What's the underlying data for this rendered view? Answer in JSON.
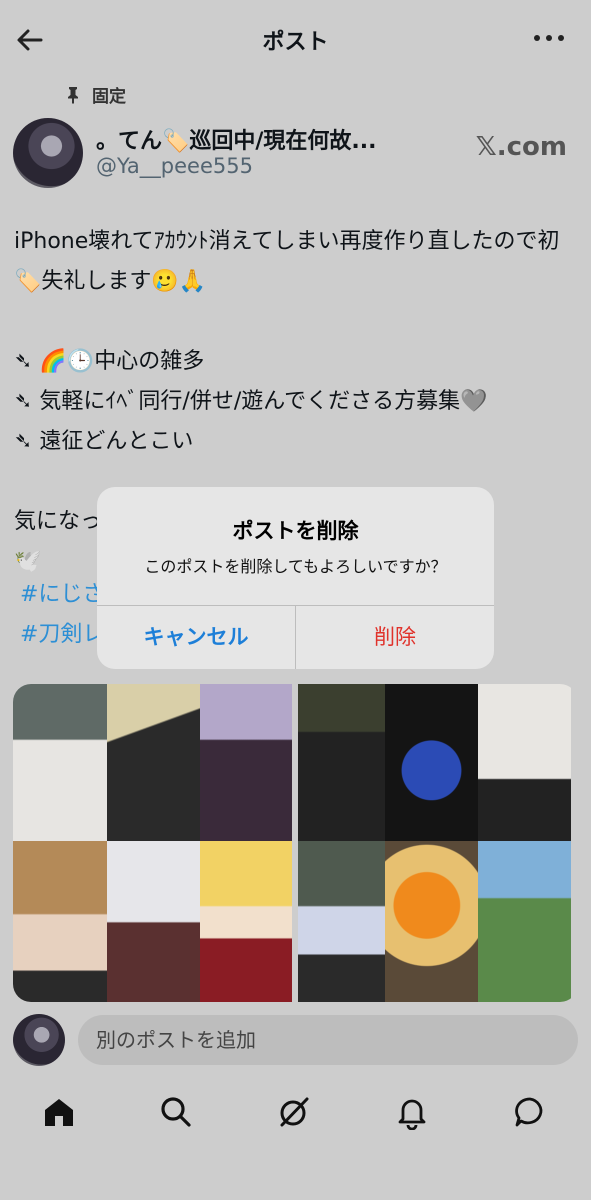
{
  "header": {
    "title": "ポスト"
  },
  "post": {
    "pinned_label": "固定",
    "author_name": "。てん🏷️巡回中/現在何故...",
    "author_handle": "@Ya__peee555",
    "source": "𝕏.com",
    "text": "iPhone壊れてｱｶｳﾝﾄ消えてしまい再度作り直したので初🏷️失礼します🥲🙏\n\n➴ 🌈🕒中心の雑多\n➴ 気軽にｲﾍﾞ同行/併せ/遊んでくださる方募集🩶\n➴ 遠征どんとこい\n\n気になった方はお気軽にお声がけお願いします\n🕊️",
    "hashtags": [
      "#にじさ",
      "#刀剣レ"
    ]
  },
  "reply": {
    "placeholder": "別のポストを追加"
  },
  "tabs": [
    "home-icon",
    "search-icon",
    "grok-icon",
    "notifications-icon",
    "messages-icon"
  ],
  "dialog": {
    "title": "ポストを削除",
    "message": "このポストを削除してもよろしいですか？",
    "cancel_label": "キャンセル",
    "delete_label": "削除"
  }
}
